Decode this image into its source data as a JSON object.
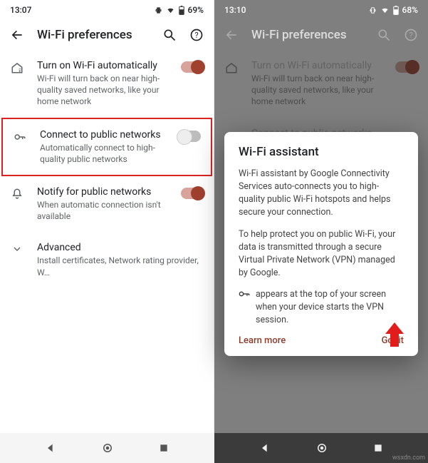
{
  "left": {
    "time": "13:07",
    "battery": "69%",
    "title": "Wi-Fi preferences",
    "rows": [
      {
        "title": "Turn on Wi-Fi automatically",
        "sub": "Wi-Fi will turn back on near high-quality saved networks, like your home network"
      },
      {
        "title": "Connect to public networks",
        "sub": "Automatically connect to high-quality public networks"
      },
      {
        "title": "Notify for public networks",
        "sub": "When automatic connection isn't available"
      },
      {
        "title": "Advanced",
        "sub": "Install certificates, Network rating provider, W…"
      }
    ]
  },
  "right": {
    "time": "13:10",
    "battery": "68%",
    "title": "Wi-Fi preferences",
    "rows": [
      {
        "title": "Turn on Wi-Fi automatically",
        "sub": "Wi-Fi will turn back on near high-quality saved networks, like your home network"
      },
      {
        "title": "Connect to public networks"
      }
    ],
    "dialog": {
      "title": "Wi-Fi assistant",
      "p1": "Wi-Fi assistant by Google Connectivity Services auto-connects you to high-quality public Wi-Fi hotspots and helps secure your connection.",
      "p2": "To help protect you on public Wi-Fi, your data is transmitted through a secure Virtual Private Network (VPN) managed by Google.",
      "p3": " appears at the top of your screen when your device starts the VPN session.",
      "learn": "Learn more",
      "got": "Got it"
    }
  },
  "watermark": "wsxdn.com"
}
